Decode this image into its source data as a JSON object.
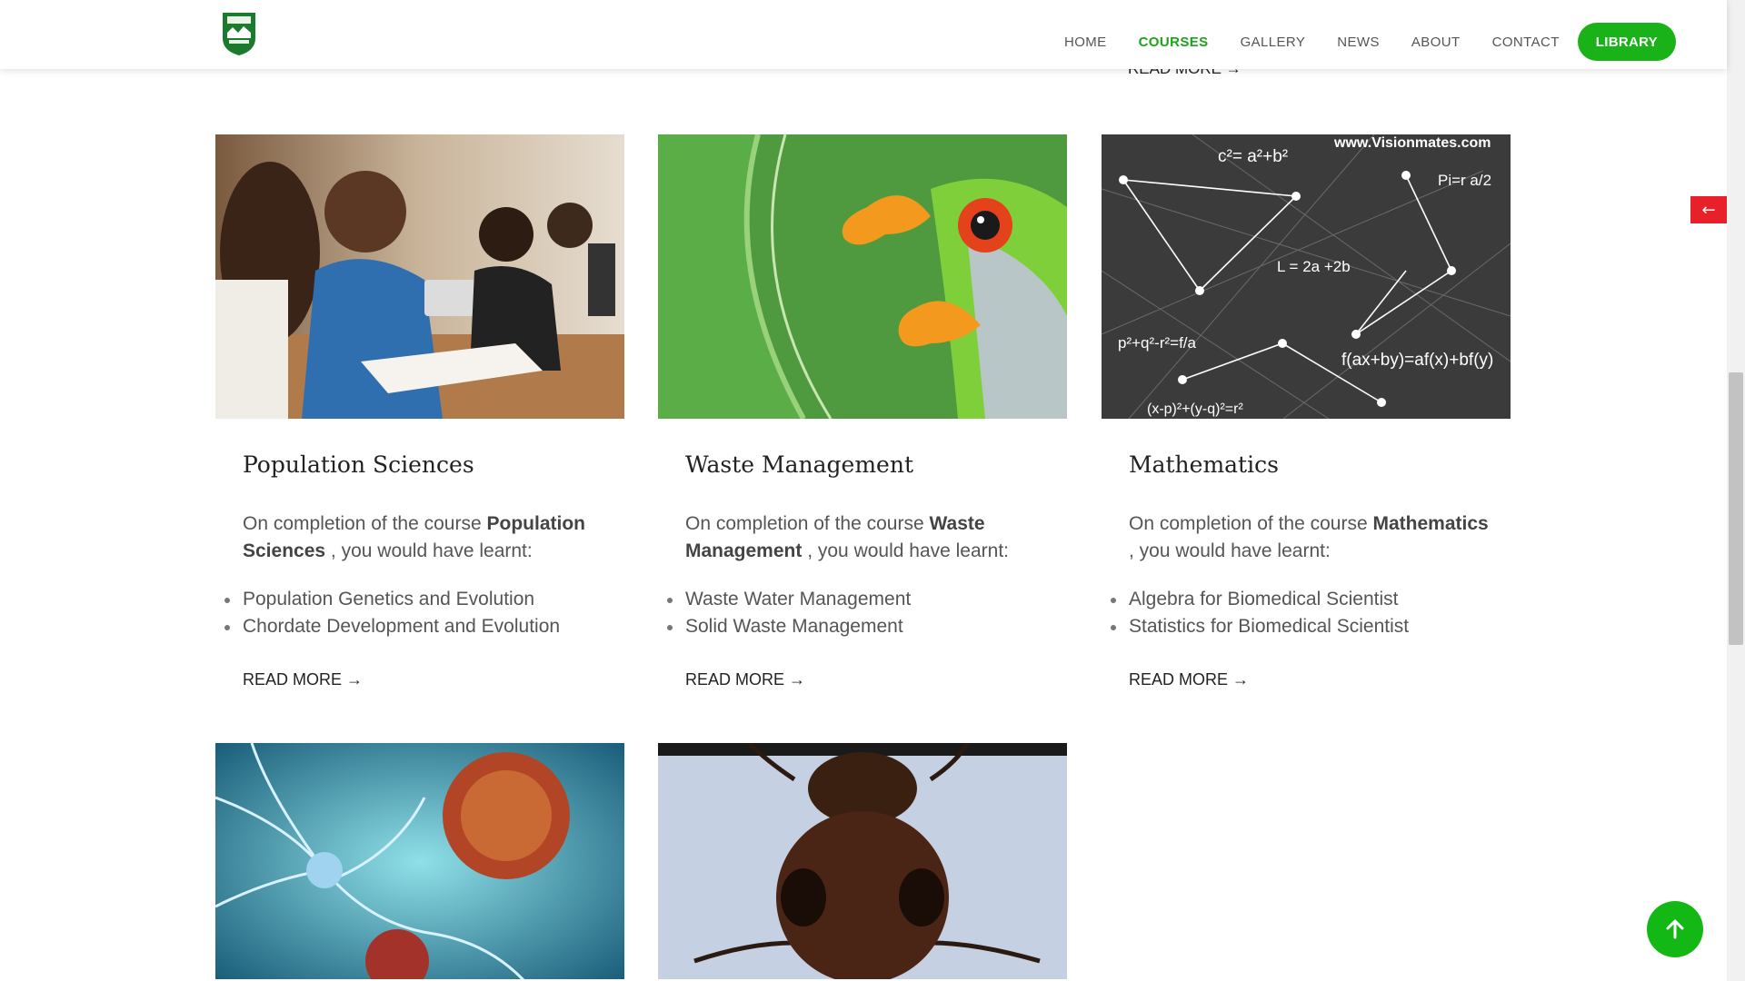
{
  "nav": {
    "items": [
      "HOME",
      "COURSES",
      "GALLERY",
      "NEWS",
      "ABOUT",
      "CONTACT"
    ],
    "active": "COURSES",
    "library_label": "LIBRARY",
    "accent_color": "#19b219"
  },
  "peek_read_more": "READ MORE →",
  "courses": [
    {
      "title": "Population Sciences",
      "desc_prefix": "On completion of the course",
      "desc_bold": "Population Sciences",
      "desc_suffix": ", you would have learnt:",
      "topics": [
        "Population Genetics and Evolution",
        "Chordate Development and Evolution"
      ],
      "read_more": "READ MORE →",
      "image": "students-with-tablet"
    },
    {
      "title": "Waste Management",
      "desc_prefix": "On completion of the course",
      "desc_bold": "Waste Management",
      "desc_suffix": ", you would have learnt:",
      "topics": [
        "Waste Water Management",
        "Solid Waste Management"
      ],
      "read_more": "READ MORE →",
      "image": "tree-frog-on-leaf"
    },
    {
      "title": "Mathematics",
      "desc_prefix": "On completion of the course",
      "desc_bold": "Mathematics",
      "desc_suffix": ", you would have learnt:",
      "topics": [
        "Algebra for Biomedical Scientist",
        "Statistics for Biomedical Scientist"
      ],
      "read_more": "READ MORE →",
      "image": "math-formulas-chalkboard"
    }
  ],
  "math_image_text": {
    "watermark": "www.Visionmates.com",
    "f1": "c²= a²+b²",
    "f2": "Pi=r a/2",
    "f3": "L = 2a +2b",
    "f4": "f(ax+by)=af(x)+bf(y)",
    "f5": "p²+q²-r²=f/a",
    "f6": "(x-p)²+(y-q)²=r²"
  },
  "bottom_images": [
    "neurons-and-virus",
    "ant-closeup"
  ],
  "side_arrow": "←",
  "to_top_icon": "arrow-up-icon"
}
